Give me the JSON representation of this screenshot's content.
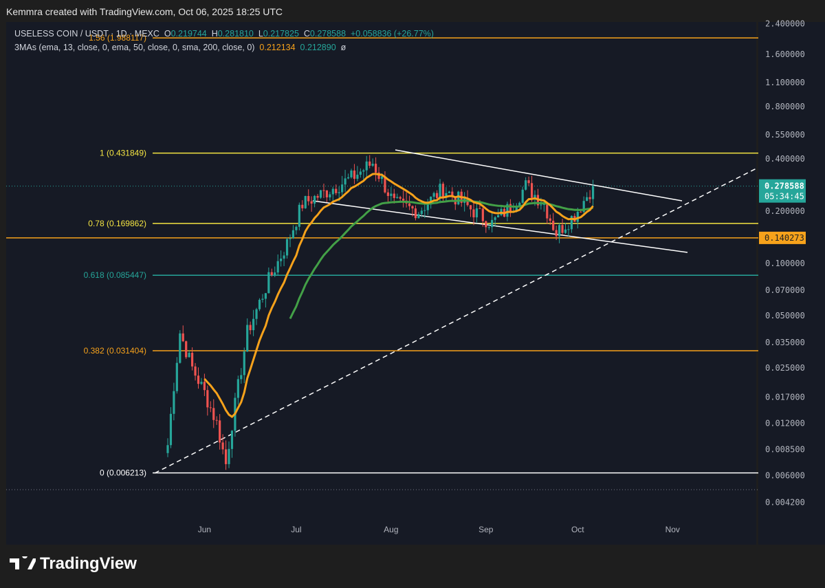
{
  "credit": "Kemmra created with TradingView.com, Oct 06, 2025 18:25 UTC",
  "legend": {
    "symbol": "USELESS COIN / USDT · 1D · MEXC",
    "o_label": "O",
    "o": "0.219744",
    "h_label": "H",
    "h": "0.281810",
    "l_label": "L",
    "l": "0.217825",
    "c_label": "C",
    "c": "0.278588",
    "change": "+0.058836 (+26.77%)",
    "ma_label": "3MAs (ema, 13, close, 0, ema, 50, close, 0, sma, 200, close, 0)",
    "ma1": "0.212134",
    "ma2": "0.212890",
    "ma3": "ø"
  },
  "brand": "TradingView",
  "colors": {
    "up": "#26a69a",
    "down": "#ef5350",
    "ema13": "#f7a21b",
    "ema50": "#43a047",
    "fib_yellow": "#f5e542",
    "fib_orange": "#f7a21b",
    "fib_teal": "#26a69a"
  },
  "chart_data": {
    "type": "candlestick",
    "title": "USELESS COIN / USDT 1D",
    "yscale": "log",
    "ylim": [
      0.0038,
      2.6
    ],
    "y_ticks": [
      "2.400000",
      "1.600000",
      "1.100000",
      "0.800000",
      "0.550000",
      "0.400000",
      "0.200000",
      "0.100000",
      "0.070000",
      "0.050000",
      "0.035000",
      "0.025000",
      "0.017000",
      "0.012000",
      "0.008500",
      "0.006000",
      "0.004200"
    ],
    "y_tick_values": [
      2.4,
      1.6,
      1.1,
      0.8,
      0.55,
      0.4,
      0.2,
      0.1,
      0.07,
      0.05,
      0.035,
      0.025,
      0.017,
      0.012,
      0.0085,
      0.006,
      0.0042
    ],
    "x_ticks": [
      {
        "label": "Jun",
        "day": 12
      },
      {
        "label": "Jul",
        "day": 42
      },
      {
        "label": "Aug",
        "day": 73
      },
      {
        "label": "Sep",
        "day": 104
      },
      {
        "label": "Oct",
        "day": 134
      },
      {
        "label": "Nov",
        "day": 165
      }
    ],
    "start_date": "May 20",
    "close_keypoints": [
      [
        0,
        0.009
      ],
      [
        2,
        0.02
      ],
      [
        4,
        0.04
      ],
      [
        8,
        0.025
      ],
      [
        12,
        0.018
      ],
      [
        16,
        0.012
      ],
      [
        19,
        0.007
      ],
      [
        21,
        0.012
      ],
      [
        26,
        0.04
      ],
      [
        33,
        0.08
      ],
      [
        39,
        0.13
      ],
      [
        44,
        0.22
      ],
      [
        52,
        0.26
      ],
      [
        60,
        0.31
      ],
      [
        67,
        0.38
      ],
      [
        74,
        0.22
      ],
      [
        82,
        0.2
      ],
      [
        90,
        0.27
      ],
      [
        100,
        0.2
      ],
      [
        106,
        0.17
      ],
      [
        113,
        0.22
      ],
      [
        117,
        0.28
      ],
      [
        123,
        0.22
      ],
      [
        127,
        0.15
      ],
      [
        133,
        0.19
      ],
      [
        139,
        0.278588
      ]
    ],
    "price_labels": [
      {
        "value": 0.278588,
        "text": "0.278588",
        "timer": "05:34:45"
      },
      {
        "value": 0.140273,
        "text": "0.140273"
      }
    ],
    "fib_levels": [
      {
        "label": "1.56 (1.988117)",
        "value": 1.988117,
        "color": "#f7a21b"
      },
      {
        "label": "1 (0.431849)",
        "value": 0.431849,
        "color": "#f5e542"
      },
      {
        "label": "0.78 (0.169862)",
        "value": 0.169862,
        "color": "#f5e542"
      },
      {
        "label": "0.618 (0.085447)",
        "value": 0.085447,
        "color": "#26a69a"
      },
      {
        "label": "0.382 (0.031404)",
        "value": 0.031404,
        "color": "#f7a21b"
      },
      {
        "label": "0 (0.006213)",
        "value": 0.006213,
        "color": "#ffffff"
      }
    ],
    "series": [
      {
        "name": "EMA 13",
        "value": "0.212134"
      },
      {
        "name": "EMA 50",
        "value": "0.212890"
      }
    ]
  }
}
